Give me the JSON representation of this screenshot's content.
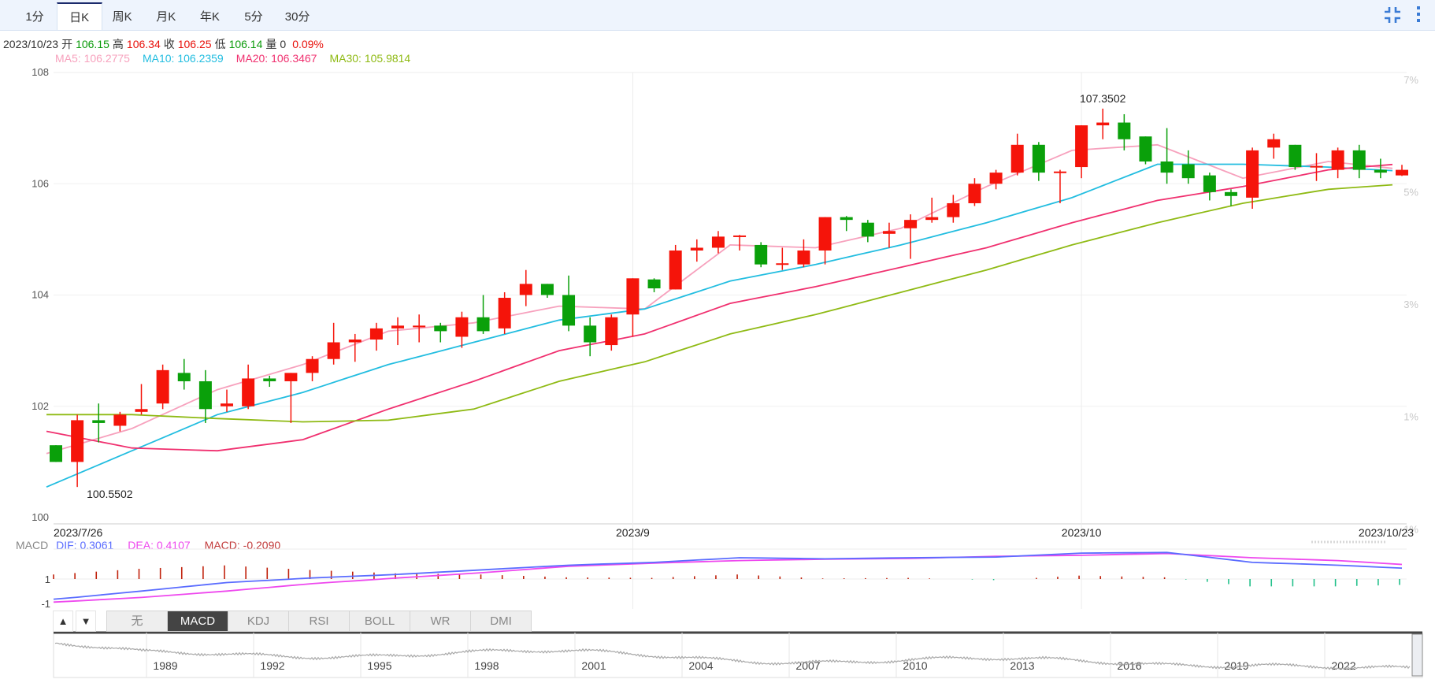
{
  "tabs": [
    {
      "label": "1分"
    },
    {
      "label": "日K",
      "active": true
    },
    {
      "label": "周K"
    },
    {
      "label": "月K"
    },
    {
      "label": "年K"
    },
    {
      "label": "5分"
    },
    {
      "label": "30分"
    }
  ],
  "toolbar_icons": [
    "compress-icon",
    "more-vertical-icon"
  ],
  "info": {
    "date": "2023/10/23",
    "items": [
      {
        "label": "开",
        "value": "106.15",
        "color": "#0a9a0a"
      },
      {
        "label": "高",
        "value": "106.34",
        "color": "#e8100a"
      },
      {
        "label": "收",
        "value": "106.25",
        "color": "#e8100a"
      },
      {
        "label": "低",
        "value": "106.14",
        "color": "#0a9a0a"
      },
      {
        "label": "量",
        "value": "0",
        "color": "#333333"
      }
    ],
    "change": "0.09%",
    "change_color": "#e8100a"
  },
  "ma_legend": [
    {
      "label": "MA5: 106.2775",
      "color": "#f7a1bd"
    },
    {
      "label": "MA10: 106.2359",
      "color": "#22bde0"
    },
    {
      "label": "MA20: 106.3467",
      "color": "#f0306f"
    },
    {
      "label": "MA30: 105.9814",
      "color": "#8fba14"
    }
  ],
  "macd_legend": {
    "title": "MACD",
    "items": [
      {
        "label": "DIF: 0.3061",
        "color": "#5a6cff"
      },
      {
        "label": "DEA: 0.4107",
        "color": "#ee48ee"
      },
      {
        "label": "MACD: -0.2090",
        "color": "#c23b3b"
      }
    ]
  },
  "indicator_tabs": [
    {
      "label": "无"
    },
    {
      "label": "MACD",
      "active": true
    },
    {
      "label": "KDJ"
    },
    {
      "label": "RSI"
    },
    {
      "label": "BOLL"
    },
    {
      "label": "WR"
    },
    {
      "label": "DMI"
    }
  ],
  "arrows": [
    "▲",
    "▼"
  ],
  "chart_data": {
    "type": "candlestick",
    "colors": {
      "up": "#f5140a",
      "down": "#0aa00a"
    },
    "ylim": [
      100,
      108
    ],
    "y_ticks": [
      "108",
      "106",
      "104",
      "102",
      "100"
    ],
    "y_tick_values": [
      108,
      106,
      104,
      102,
      100
    ],
    "right_ticks": [
      "7%",
      "5%",
      "3%",
      "1%",
      "-1%"
    ],
    "right_tick_values": [
      7,
      5,
      3,
      1,
      -1
    ],
    "x_labels": [
      {
        "label": "2023/7/26",
        "index": 0
      },
      {
        "label": "2023/9",
        "index": 27
      },
      {
        "label": "2023/10",
        "index": 48
      },
      {
        "label": "2023/10/23",
        "index": 63
      }
    ],
    "grid_x_indices": [
      27,
      48
    ],
    "annotations": [
      {
        "label": "107.3502",
        "index": 49,
        "value": 107.3502,
        "kind": "high"
      },
      {
        "label": "100.5502",
        "index": 1,
        "value": 100.5502,
        "kind": "low"
      }
    ],
    "ohlc": [
      [
        101.3,
        101.3,
        101.0,
        101.0
      ],
      [
        101.0,
        101.85,
        100.55,
        101.75
      ],
      [
        101.75,
        102.05,
        101.35,
        101.7
      ],
      [
        101.65,
        101.9,
        101.55,
        101.85
      ],
      [
        101.9,
        102.4,
        101.85,
        101.95
      ],
      [
        102.05,
        102.75,
        101.95,
        102.65
      ],
      [
        102.6,
        102.85,
        102.3,
        102.45
      ],
      [
        102.45,
        102.65,
        101.7,
        101.95
      ],
      [
        102.0,
        102.3,
        101.9,
        102.05
      ],
      [
        102.0,
        102.75,
        101.95,
        102.5
      ],
      [
        102.5,
        102.55,
        102.35,
        102.45
      ],
      [
        102.45,
        102.6,
        101.7,
        102.6
      ],
      [
        102.6,
        102.9,
        102.45,
        102.85
      ],
      [
        102.85,
        103.5,
        102.75,
        103.15
      ],
      [
        103.15,
        103.3,
        102.8,
        103.2
      ],
      [
        103.2,
        103.5,
        103.0,
        103.4
      ],
      [
        103.4,
        103.6,
        103.1,
        103.45
      ],
      [
        103.42,
        103.65,
        103.15,
        103.45
      ],
      [
        103.45,
        103.5,
        103.15,
        103.35
      ],
      [
        103.25,
        103.7,
        103.05,
        103.6
      ],
      [
        103.6,
        104.0,
        103.3,
        103.35
      ],
      [
        103.4,
        104.05,
        103.3,
        103.95
      ],
      [
        104.0,
        104.45,
        103.8,
        104.2
      ],
      [
        104.2,
        104.2,
        103.95,
        104.0
      ],
      [
        104.0,
        104.35,
        103.35,
        103.45
      ],
      [
        103.45,
        103.6,
        102.9,
        103.15
      ],
      [
        103.1,
        103.65,
        103.0,
        103.6
      ],
      [
        103.65,
        104.3,
        103.25,
        104.3
      ],
      [
        104.28,
        104.3,
        104.05,
        104.12
      ],
      [
        104.1,
        104.9,
        104.1,
        104.8
      ],
      [
        104.8,
        105.0,
        104.6,
        104.85
      ],
      [
        104.85,
        105.15,
        104.75,
        105.05
      ],
      [
        105.05,
        105.08,
        104.8,
        105.07
      ],
      [
        104.9,
        104.95,
        104.5,
        104.55
      ],
      [
        104.55,
        104.85,
        104.45,
        104.57
      ],
      [
        104.55,
        105.0,
        104.5,
        104.8
      ],
      [
        104.8,
        105.4,
        104.55,
        105.4
      ],
      [
        105.4,
        105.42,
        105.15,
        105.35
      ],
      [
        105.3,
        105.35,
        104.95,
        105.05
      ],
      [
        105.1,
        105.3,
        104.85,
        105.15
      ],
      [
        105.2,
        105.45,
        104.65,
        105.35
      ],
      [
        105.35,
        105.75,
        105.3,
        105.4
      ],
      [
        105.4,
        105.8,
        105.3,
        105.65
      ],
      [
        105.65,
        106.1,
        105.6,
        106.0
      ],
      [
        106.0,
        106.25,
        105.9,
        106.2
      ],
      [
        106.2,
        106.9,
        106.15,
        106.7
      ],
      [
        106.7,
        106.75,
        106.05,
        106.2
      ],
      [
        106.2,
        106.25,
        105.65,
        106.22
      ],
      [
        106.3,
        107.05,
        106.1,
        107.05
      ],
      [
        107.05,
        107.3502,
        106.8,
        107.1
      ],
      [
        107.1,
        107.25,
        106.6,
        106.8
      ],
      [
        106.85,
        106.85,
        106.35,
        106.4
      ],
      [
        106.4,
        107.0,
        106.0,
        106.2
      ],
      [
        106.35,
        106.6,
        106.0,
        106.1
      ],
      [
        106.15,
        106.2,
        105.7,
        105.85
      ],
      [
        105.85,
        105.9,
        105.6,
        105.78
      ],
      [
        105.75,
        106.65,
        105.55,
        106.6
      ],
      [
        106.65,
        106.9,
        106.45,
        106.8
      ],
      [
        106.7,
        106.7,
        106.25,
        106.3
      ],
      [
        106.3,
        106.55,
        106.05,
        106.32
      ],
      [
        106.25,
        106.65,
        106.1,
        106.6
      ],
      [
        106.6,
        106.7,
        106.1,
        106.25
      ],
      [
        106.25,
        106.45,
        106.1,
        106.2
      ],
      [
        106.15,
        106.34,
        106.14,
        106.25
      ]
    ],
    "ma_sample_indices": [
      0,
      4,
      8,
      12,
      16,
      20,
      24,
      28,
      32,
      36,
      40,
      44,
      48,
      52,
      56,
      60,
      63
    ],
    "ma": [
      {
        "name": "MA5",
        "color": "#f7a1bd",
        "values": [
          101.15,
          101.6,
          102.3,
          102.75,
          103.35,
          103.5,
          103.8,
          103.75,
          104.9,
          104.85,
          105.2,
          105.95,
          106.6,
          106.7,
          106.1,
          106.4,
          106.2775
        ]
      },
      {
        "name": "MA10",
        "color": "#22bde0",
        "values": [
          100.55,
          101.2,
          101.85,
          102.25,
          102.75,
          103.15,
          103.55,
          103.75,
          104.25,
          104.55,
          104.9,
          105.3,
          105.75,
          106.35,
          106.35,
          106.3,
          106.2359
        ]
      },
      {
        "name": "MA20",
        "color": "#f0306f",
        "values": [
          101.55,
          101.25,
          101.2,
          101.4,
          101.95,
          102.45,
          103.0,
          103.3,
          103.85,
          104.15,
          104.5,
          104.85,
          105.3,
          105.7,
          105.95,
          106.25,
          106.3467
        ]
      },
      {
        "name": "MA30",
        "color": "#8fba14",
        "values": [
          101.85,
          101.85,
          101.78,
          101.72,
          101.75,
          101.95,
          102.45,
          102.8,
          103.3,
          103.65,
          104.05,
          104.45,
          104.9,
          105.3,
          105.65,
          105.9,
          105.9814
        ]
      }
    ],
    "macd": {
      "y_ticks": [
        "1",
        "-1"
      ],
      "dif": {
        "color": "#5a6cff",
        "values": [
          -0.57,
          -0.34,
          -0.1,
          0.03,
          0.13,
          0.26,
          0.39,
          0.47,
          0.6,
          0.57,
          0.6,
          0.62,
          0.73,
          0.75,
          0.47,
          0.39,
          0.3061
        ]
      },
      "dea": {
        "color": "#ee48ee",
        "values": [
          -0.65,
          -0.52,
          -0.34,
          -0.13,
          0.03,
          0.18,
          0.36,
          0.45,
          0.52,
          0.56,
          0.58,
          0.64,
          0.67,
          0.72,
          0.6,
          0.52,
          0.4107
        ]
      },
      "hist_colors": {
        "up": "#c0200a",
        "down": "#22c08a"
      }
    },
    "navigator": {
      "years": [
        "1989",
        "1992",
        "1995",
        "1998",
        "2001",
        "2004",
        "2007",
        "2010",
        "2013",
        "2016",
        "2019",
        "2022"
      ]
    }
  }
}
